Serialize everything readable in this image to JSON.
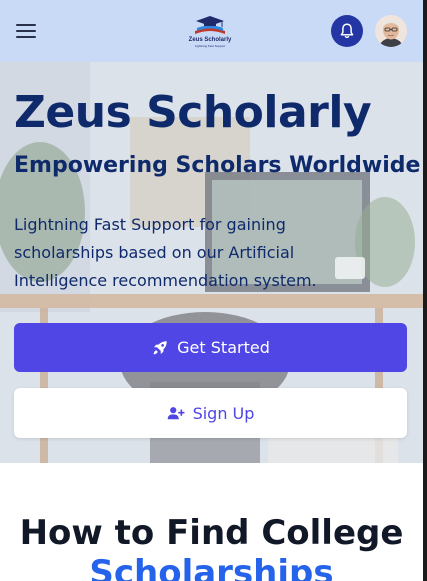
{
  "header": {
    "menu_icon": "hamburger-menu-icon",
    "logo": {
      "name": "Zeus Scholarly",
      "tagline": "Lightning Fast Support"
    },
    "notification_icon": "bell-icon",
    "avatar_icon": "user-avatar"
  },
  "hero": {
    "title": "Zeus Scholarly",
    "subtitle": "Empowering Scholars Worldwide",
    "description": "Lightning Fast Support for gaining scholarships based on our Artificial Intelligence recommendation system.",
    "primary_button": {
      "label": "Get Started",
      "icon": "rocket-icon"
    },
    "secondary_button": {
      "label": "Sign Up",
      "icon": "user-plus-icon"
    }
  },
  "section": {
    "title_line1": "How to Find College",
    "title_line2": "Scholarships"
  },
  "colors": {
    "topbar": "#c9daf7",
    "primary": "#4f46e5",
    "navy": "#0f2a6b",
    "accent_blue": "#2563eb",
    "bell_bg": "#2336a3"
  }
}
